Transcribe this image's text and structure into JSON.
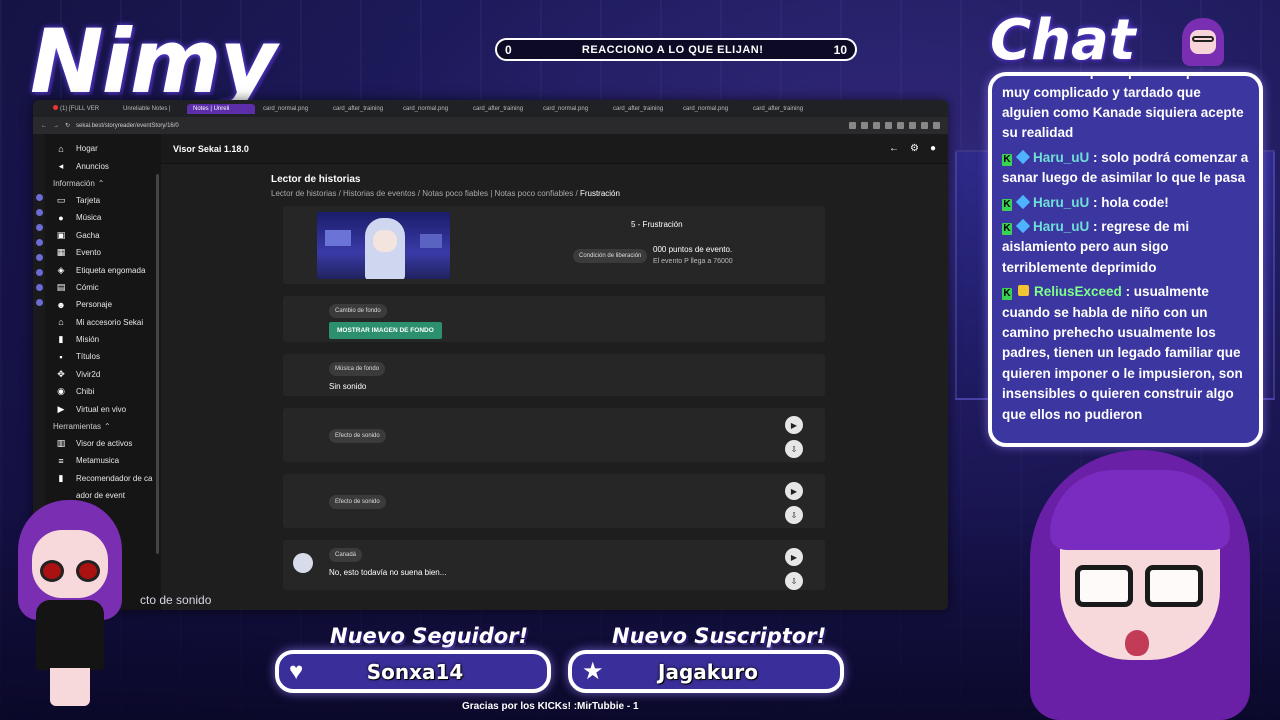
{
  "overlay": {
    "streamer_name": "Nimy",
    "chat_title": "Chat",
    "counter": {
      "left": "0",
      "label": "REACCIONO A LO QUE ELIJAN!",
      "right": "10"
    },
    "follower_title": "Nuevo Seguidor!",
    "follower_name": "Sonxa14",
    "sub_title": "Nuevo Suscriptor!",
    "sub_name": "Jagakuro",
    "footer": "Gracias por los KICKs! :MirTubbie - 1",
    "chibi_caption": "cto de sonido"
  },
  "browser": {
    "tabs": [
      "(1) [FULL VER",
      "Unreliable Notes |",
      "Notes | Unreli",
      "card_normal.png",
      "card_after_training",
      "card_normal.png",
      "card_after_training",
      "card_normal.png",
      "card_after_training",
      "card_normal.png",
      "card_after_training"
    ],
    "url": "sekai.best/storyreader/eventStory/16/0"
  },
  "app": {
    "title": "Visor Sekai 1.18.0",
    "nav": [
      {
        "icon": "⌂",
        "icon_name": "home-icon",
        "label": "Hogar"
      },
      {
        "icon": "◂",
        "icon_name": "announce-icon",
        "label": "Anuncios"
      }
    ],
    "section_info": "Información",
    "nav_info": [
      {
        "icon": "▭",
        "icon_name": "card-icon",
        "label": "Tarjeta"
      },
      {
        "icon": "●",
        "icon_name": "music-icon",
        "label": "Música"
      },
      {
        "icon": "▣",
        "icon_name": "gacha-icon",
        "label": "Gacha"
      },
      {
        "icon": "▦",
        "icon_name": "event-icon",
        "label": "Evento"
      },
      {
        "icon": "◈",
        "icon_name": "sticker-icon",
        "label": "Etiqueta engomada"
      },
      {
        "icon": "▤",
        "icon_name": "comic-icon",
        "label": "Cómic"
      },
      {
        "icon": "☻",
        "icon_name": "character-icon",
        "label": "Personaje"
      },
      {
        "icon": "⌂",
        "icon_name": "accessory-icon",
        "label": "Mi accesorio Sekai"
      },
      {
        "icon": "▮",
        "icon_name": "mission-icon",
        "label": "Misión"
      },
      {
        "icon": "▪",
        "icon_name": "titles-icon",
        "label": "Títulos"
      },
      {
        "icon": "✥",
        "icon_name": "vivir2d-icon",
        "label": "Vivir2d"
      },
      {
        "icon": "◉",
        "icon_name": "chibi-icon",
        "label": "Chibi"
      },
      {
        "icon": "▶",
        "icon_name": "live-icon",
        "label": "Virtual en vivo"
      }
    ],
    "section_tools": "Herramientas",
    "nav_tools": [
      {
        "icon": "▥",
        "icon_name": "asset-viewer-icon",
        "label": "Visor de activos"
      },
      {
        "icon": "≡",
        "icon_name": "metamusic-icon",
        "label": "Metamusica"
      },
      {
        "icon": "▮",
        "icon_name": "recommender-icon",
        "label": "Recomendador de ca"
      },
      {
        "icon": "",
        "icon_name": "event-tool-icon",
        "label": "ador de event"
      }
    ],
    "page_heading": "Lector de historias",
    "breadcrumbs": [
      "Lector de historias",
      "Historias de eventos",
      "Notas poco fiables | Notas poco confiables"
    ],
    "breadcrumb_current": "Frustración",
    "episode": {
      "title": "5 - Frustración",
      "condition_label": "Condición de liberación",
      "condition_value": "000 puntos de evento.",
      "condition_sub": "El evento P llega a 76000"
    },
    "bg_change_label": "Cambio de fondo",
    "show_bg_button": "MOSTRAR IMAGEN DE FONDO",
    "bgm_label": "Música de fondo",
    "bgm_value": "Sin sonido",
    "sfx_label_1": "Efecto de sonido",
    "sfx_label_2": "Efecto de sonido",
    "dialog_name": "Canadá",
    "dialog_text": "No, esto todavía no suena bien..."
  },
  "chat": {
    "messages": [
      {
        "user": "",
        "text": "fuertemente ligada a Kanade de acuerdo a lo que le pasa se que es muy complicado y tardado que alguien como Kanade siquiera acepte su realidad"
      },
      {
        "user": "Haru_uU",
        "text": ": solo podrá comenzar a sanar luego de asimilar lo que le pasa"
      },
      {
        "user": "Haru_uU",
        "text": ": hola code!"
      },
      {
        "user": "Haru_uU",
        "text": ": regrese de mi aislamiento pero aun sigo terriblemente deprimido"
      },
      {
        "user": "ReliusExceed",
        "text": ": usualmente cuando se habla de niño con un camino prehecho usualmente los padres, tienen un legado familiar que quieren imponer o le impusieron, son insensibles o quieren construir algo que ellos no pudieron"
      }
    ]
  },
  "colors": {
    "accent": "#3c36a0",
    "green_button": "#2c8f6e",
    "tab_active": "#5c2ea8"
  }
}
